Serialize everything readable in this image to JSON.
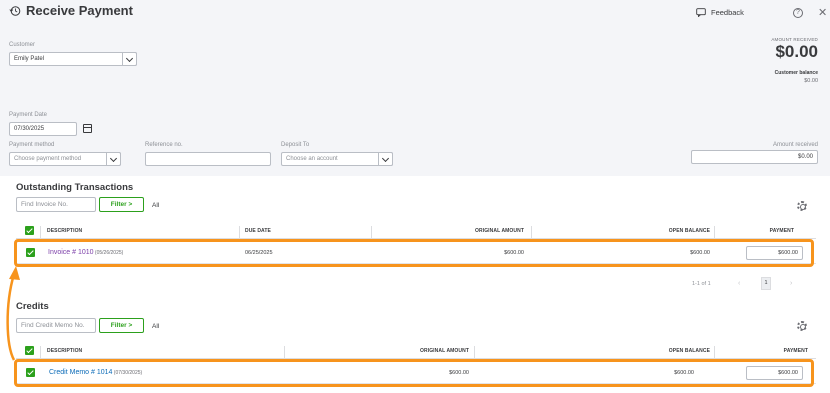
{
  "header": {
    "title": "Receive Payment",
    "feedback_label": "Feedback",
    "help_symbol": "?",
    "close_symbol": "✕"
  },
  "form": {
    "customer_label": "Customer",
    "customer_value": "Emily Patel",
    "payment_date_label": "Payment Date",
    "payment_date_value": "07/30/2025",
    "payment_method_label": "Payment method",
    "payment_method_placeholder": "Choose payment method",
    "reference_label": "Reference no.",
    "reference_value": "",
    "deposit_to_label": "Deposit To",
    "deposit_to_placeholder": "Choose an account",
    "amount_received_label": "Amount received",
    "amount_received_value": "$0.00"
  },
  "summary": {
    "amount_received_caption": "AMOUNT RECEIVED",
    "amount_received_value": "$0.00",
    "customer_balance_caption": "Customer balance",
    "customer_balance_value": "$0.00"
  },
  "outstanding": {
    "title": "Outstanding Transactions",
    "search_placeholder": "Find Invoice No.",
    "filter_label": "Filter  >",
    "all_label": "All",
    "columns": {
      "description": "DESCRIPTION",
      "due_date": "DUE DATE",
      "original_amount": "ORIGINAL AMOUNT",
      "open_balance": "OPEN BALANCE",
      "payment": "PAYMENT"
    },
    "rows": [
      {
        "description_link": "Invoice # 1010",
        "description_date": " (05/26/2025)",
        "due_date": "06/25/2025",
        "original_amount": "$600.00",
        "open_balance": "$600.00",
        "payment": "$600.00"
      }
    ],
    "pager": {
      "range": "1-1 of 1",
      "prev": "‹",
      "page": "1",
      "next": "›"
    }
  },
  "credits": {
    "title": "Credits",
    "search_placeholder": "Find Credit Memo No.",
    "filter_label": "Filter  >",
    "all_label": "All",
    "columns": {
      "description": "DESCRIPTION",
      "original_amount": "ORIGINAL AMOUNT",
      "open_balance": "OPEN BALANCE",
      "payment": "PAYMENT"
    },
    "rows": [
      {
        "description_link": "Credit Memo # 1014",
        "description_date": " (07/30/2025)",
        "original_amount": "$600.00",
        "open_balance": "$600.00",
        "payment": "$600.00"
      }
    ]
  },
  "colors": {
    "accent_green": "#2ca01c",
    "highlight_orange": "#f7941d",
    "invoice_link": "#7b3ea8",
    "credit_link": "#0d6cb8"
  }
}
